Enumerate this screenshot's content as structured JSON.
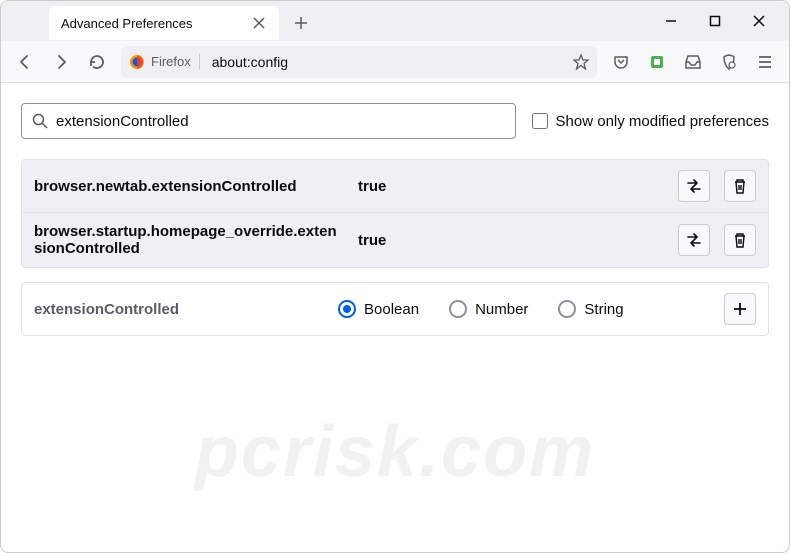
{
  "tab": {
    "title": "Advanced Preferences"
  },
  "urlbar": {
    "brand": "Firefox",
    "url": "about:config"
  },
  "search": {
    "value": "extensionControlled",
    "checkbox_label": "Show only modified preferences"
  },
  "prefs": [
    {
      "name": "browser.newtab.extensionControlled",
      "value": "true"
    },
    {
      "name": "browser.startup.homepage_override.extensionControlled",
      "value": "true"
    }
  ],
  "add": {
    "name": "extensionControlled",
    "types": {
      "boolean": "Boolean",
      "number": "Number",
      "string": "String"
    },
    "selected": "boolean"
  },
  "watermark": "pcrisk.com"
}
